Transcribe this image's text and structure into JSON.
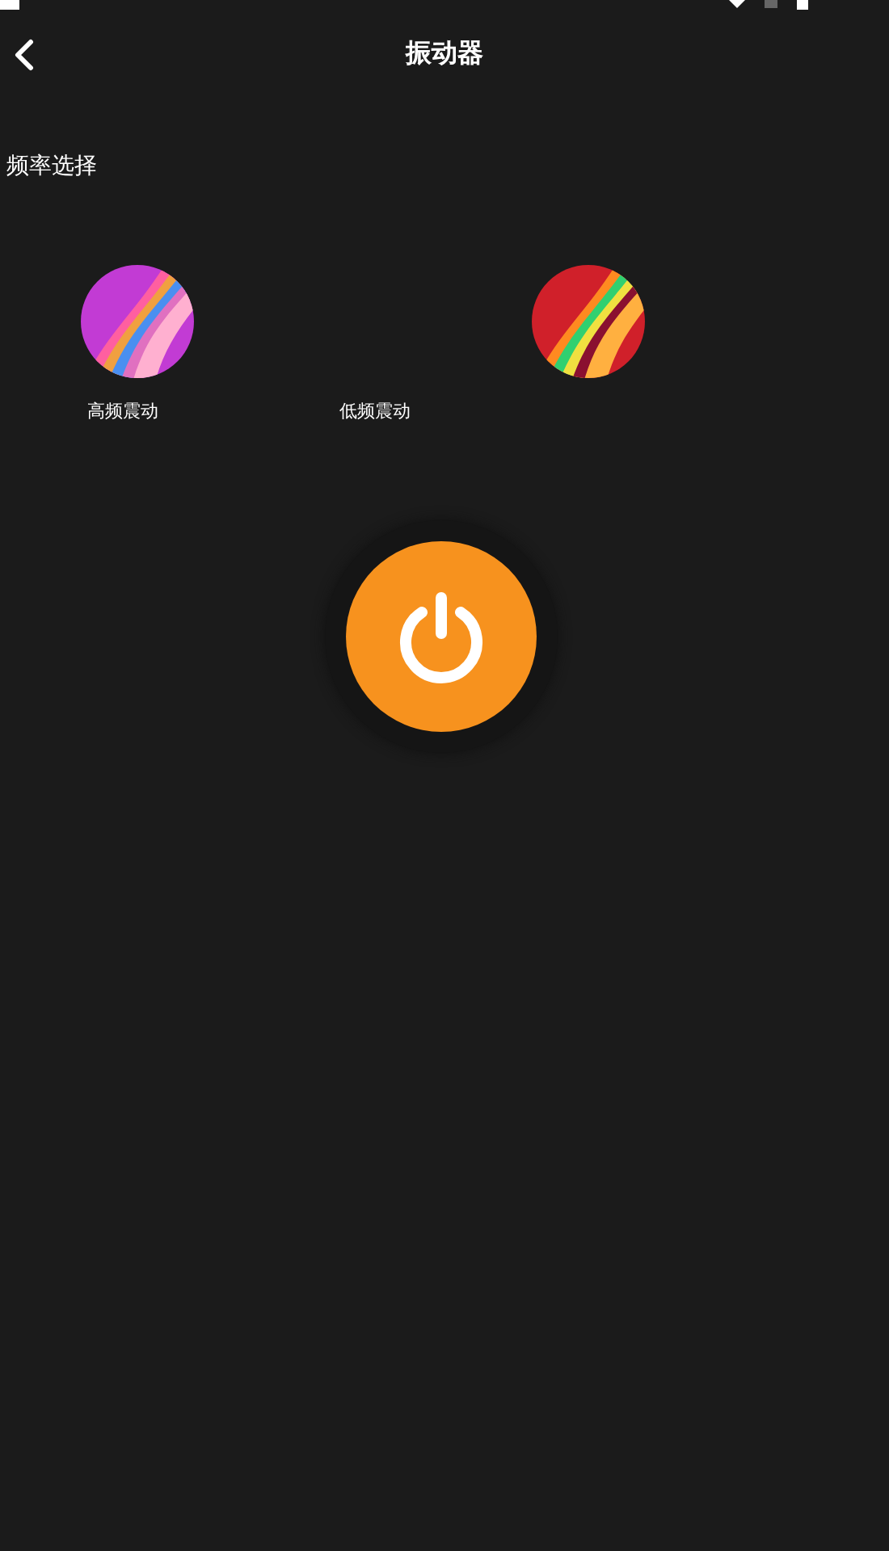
{
  "app_bar": {
    "title": "振动器"
  },
  "section_title": "频率选择",
  "options": [
    {
      "label": "高频震动"
    },
    {
      "label": "低频震动"
    }
  ]
}
